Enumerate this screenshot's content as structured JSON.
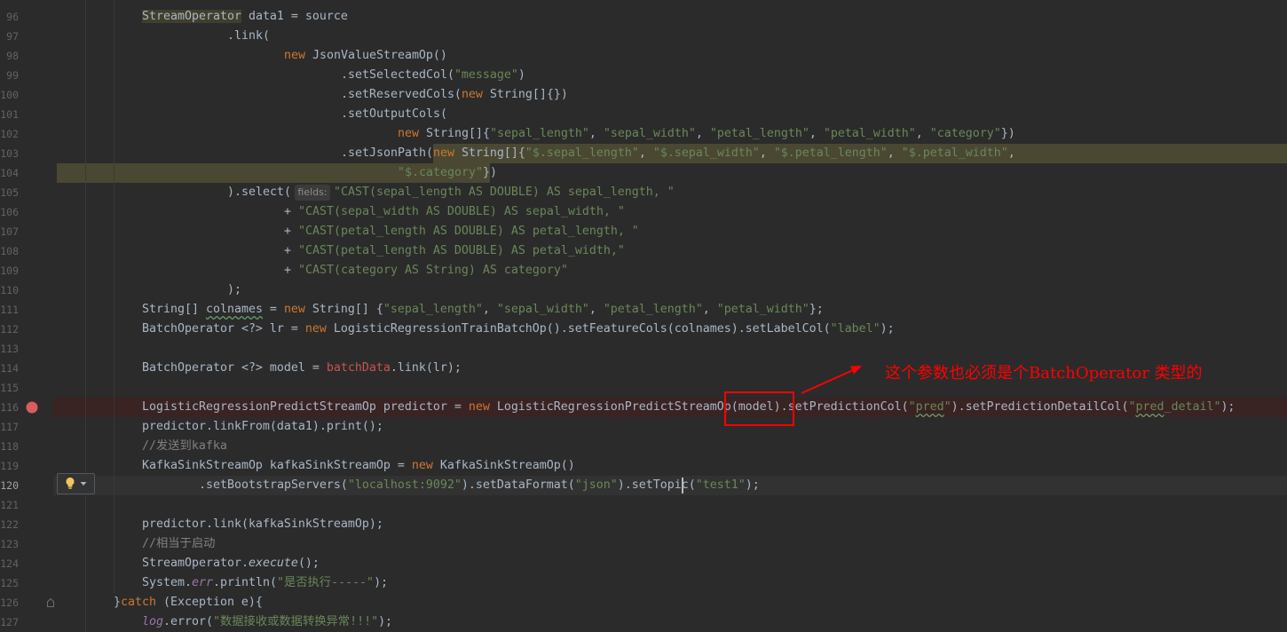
{
  "theme": {
    "background": "#2B2B2B",
    "text": "#A9B7C6",
    "keyword": "#CC7832",
    "string": "#6A8759",
    "comment": "#808080",
    "field": "#9876AA",
    "unresolved": "#C75450",
    "line_number": "#606366",
    "breakpoint": "#DB5C5C",
    "breakpoint_line": "#3A2323",
    "current_line": "#323232",
    "selection": "#4A4832",
    "typo_underline": "#659C6B",
    "annotation": "#FF0000"
  },
  "icons": {
    "breakpoint": "breakpoint-icon",
    "intention": "lightbulb-icon",
    "intention_menu": "chevron-down-icon",
    "fold": "fold-end-icon"
  },
  "editor": {
    "lines": [
      {
        "num": "96",
        "tokens": [
          [
            "usage-highlight",
            "StreamOperator"
          ],
          [
            "plain",
            " data1 = source"
          ]
        ]
      },
      {
        "num": "97",
        "tokens": [
          [
            "plain",
            ".link("
          ]
        ]
      },
      {
        "num": "98",
        "tokens": [
          [
            "keyword",
            "new"
          ],
          [
            "plain",
            " JsonValueStreamOp()"
          ]
        ]
      },
      {
        "num": "99",
        "tokens": [
          [
            "plain",
            ".setSelectedCol("
          ],
          [
            "string",
            "\"message\""
          ],
          [
            "plain",
            ")"
          ]
        ]
      },
      {
        "num": "100",
        "tokens": [
          [
            "plain",
            ".setReservedCols("
          ],
          [
            "keyword",
            "new"
          ],
          [
            "plain",
            " String[]{})"
          ]
        ]
      },
      {
        "num": "101",
        "tokens": [
          [
            "plain",
            ".setOutputCols("
          ]
        ]
      },
      {
        "num": "102",
        "tokens": [
          [
            "keyword",
            "new"
          ],
          [
            "plain",
            " String[]{"
          ],
          [
            "string",
            "\"sepal_length\""
          ],
          [
            "plain",
            ", "
          ],
          [
            "string",
            "\"sepal_width\""
          ],
          [
            "plain",
            ", "
          ],
          [
            "string",
            "\"petal_length\""
          ],
          [
            "plain",
            ", "
          ],
          [
            "string",
            "\"petal_width\""
          ],
          [
            "plain",
            ", "
          ],
          [
            "string",
            "\"category\""
          ],
          [
            "plain",
            "})"
          ]
        ]
      },
      {
        "num": "103",
        "tokens": [
          [
            "plain",
            ".setJsonPath("
          ],
          [
            "keyword",
            "new"
          ],
          [
            "plain",
            " String[]{"
          ],
          [
            "string",
            "\"$.sepal_length\""
          ],
          [
            "plain",
            ", "
          ],
          [
            "string",
            "\"$.sepal_width\""
          ],
          [
            "plain",
            ", "
          ],
          [
            "string",
            "\"$.petal_length\""
          ],
          [
            "plain",
            ", "
          ],
          [
            "string",
            "\"$.petal_width\""
          ],
          [
            "plain",
            ","
          ]
        ]
      },
      {
        "num": "104",
        "tokens": [
          [
            "string",
            "\"$.category\""
          ],
          [
            "plain",
            "})"
          ]
        ]
      },
      {
        "num": "105",
        "tokens": [
          [
            "plain",
            ").select("
          ],
          [
            "param-hint",
            "fields:"
          ],
          [
            "string",
            "\"CAST(sepal_length AS DOUBLE) AS sepal_length, \""
          ]
        ]
      },
      {
        "num": "106",
        "tokens": [
          [
            "plain",
            "+ "
          ],
          [
            "string",
            "\"CAST(sepal_width AS DOUBLE) AS sepal_width, \""
          ]
        ]
      },
      {
        "num": "107",
        "tokens": [
          [
            "plain",
            "+ "
          ],
          [
            "string",
            "\"CAST(petal_length AS DOUBLE) AS petal_length, \""
          ]
        ]
      },
      {
        "num": "108",
        "tokens": [
          [
            "plain",
            "+ "
          ],
          [
            "string",
            "\"CAST(petal_length AS DOUBLE) AS petal_width,\""
          ]
        ]
      },
      {
        "num": "109",
        "tokens": [
          [
            "plain",
            "+ "
          ],
          [
            "string",
            "\"CAST(category AS String) AS category\""
          ]
        ]
      },
      {
        "num": "110",
        "tokens": [
          [
            "plain",
            ");"
          ]
        ]
      },
      {
        "num": "111",
        "tokens": [
          [
            "plain",
            "String[] "
          ],
          [
            "typo",
            "colnames"
          ],
          [
            "plain",
            " = "
          ],
          [
            "keyword",
            "new"
          ],
          [
            "plain",
            " String[] {"
          ],
          [
            "string",
            "\"sepal_length\""
          ],
          [
            "plain",
            ", "
          ],
          [
            "string",
            "\"sepal_width\""
          ],
          [
            "plain",
            ", "
          ],
          [
            "string",
            "\"petal_length\""
          ],
          [
            "plain",
            ", "
          ],
          [
            "string",
            "\"petal_width\""
          ],
          [
            "plain",
            "};"
          ]
        ]
      },
      {
        "num": "112",
        "tokens": [
          [
            "plain",
            "BatchOperator <?> lr = "
          ],
          [
            "keyword",
            "new"
          ],
          [
            "plain",
            " LogisticRegressionTrainBatchOp().setFeatureCols(colnames).setLabelCol("
          ],
          [
            "string",
            "\"label\""
          ],
          [
            "plain",
            ");"
          ]
        ]
      },
      {
        "num": "113",
        "tokens": []
      },
      {
        "num": "114",
        "tokens": [
          [
            "plain",
            "BatchOperator <?> model = "
          ],
          [
            "unresolved",
            "batchData"
          ],
          [
            "plain",
            ".link(lr);"
          ]
        ]
      },
      {
        "num": "115",
        "tokens": []
      },
      {
        "num": "116",
        "breakpoint": true,
        "tokens": [
          [
            "plain",
            "LogisticRegressionPredictStreamOp predictor = "
          ],
          [
            "keyword",
            "new"
          ],
          [
            "plain",
            " LogisticRegressionPredictStreamOp(model).setPredictionCol("
          ],
          [
            "string",
            "\""
          ],
          [
            "string-typo",
            "pred"
          ],
          [
            "string",
            "\""
          ],
          [
            "plain",
            ").setPredictionDetailCol("
          ],
          [
            "string",
            "\""
          ],
          [
            "string-typo",
            "pred"
          ],
          [
            "string",
            "_detail\""
          ],
          [
            "plain",
            ");"
          ]
        ]
      },
      {
        "num": "117",
        "tokens": [
          [
            "plain",
            "predictor.linkFrom(data1).print();"
          ]
        ]
      },
      {
        "num": "118",
        "tokens": [
          [
            "comment",
            "//发送到kafka"
          ]
        ]
      },
      {
        "num": "119",
        "tokens": [
          [
            "plain",
            "KafkaSinkStreamOp kafkaSinkStreamOp = "
          ],
          [
            "keyword",
            "new"
          ],
          [
            "plain",
            " KafkaSinkStreamOp()"
          ]
        ]
      },
      {
        "num": "120",
        "current": true,
        "tokens": [
          [
            "plain",
            ".setBootstrapServers("
          ],
          [
            "string",
            "\"localhost:9092\""
          ],
          [
            "plain",
            ").setDataFormat("
          ],
          [
            "string",
            "\"json\""
          ],
          [
            "plain",
            ").setTopi"
          ],
          [
            "caret"
          ],
          [
            "plain",
            "c("
          ],
          [
            "string",
            "\"test1\""
          ],
          [
            "plain",
            ");"
          ]
        ]
      },
      {
        "num": "121",
        "tokens": []
      },
      {
        "num": "122",
        "tokens": [
          [
            "plain",
            "predictor.link(kafkaSinkStreamOp);"
          ]
        ]
      },
      {
        "num": "123",
        "tokens": [
          [
            "comment",
            "//相当于启动"
          ]
        ]
      },
      {
        "num": "124",
        "tokens": [
          [
            "plain",
            "StreamOperator."
          ],
          [
            "static-method",
            "execute"
          ],
          [
            "plain",
            "();"
          ]
        ]
      },
      {
        "num": "125",
        "tokens": [
          [
            "plain",
            "System."
          ],
          [
            "static-field",
            "err"
          ],
          [
            "plain",
            ".println("
          ],
          [
            "string",
            "\"是否执行-----\""
          ],
          [
            "plain",
            ");"
          ]
        ]
      },
      {
        "num": "126",
        "tokens": [
          [
            "plain",
            "}"
          ],
          [
            "keyword",
            "catch"
          ],
          [
            "plain",
            " (Exception e){"
          ]
        ]
      },
      {
        "num": "127",
        "tokens": [
          [
            "static-field",
            "log"
          ],
          [
            "plain",
            ".error("
          ],
          [
            "string",
            "\"数据接收或数据转换异常!!!\""
          ],
          [
            "plain",
            ");"
          ]
        ]
      }
    ]
  },
  "annotation": {
    "text": "这个参数也必须是个BatchOperator 类型的"
  }
}
